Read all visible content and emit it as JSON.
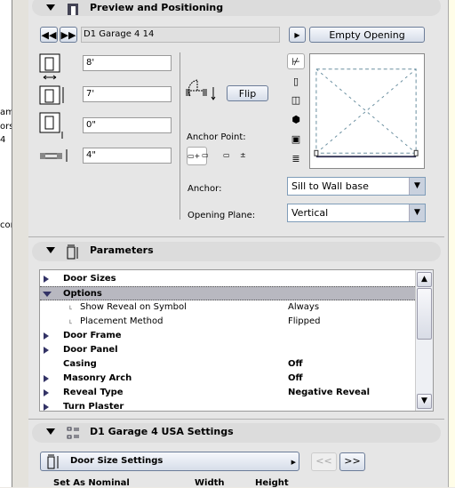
{
  "left_fragments": [
    "am",
    "ors",
    "4",
    "cor"
  ],
  "preview_section": {
    "title": "Preview and Positioning",
    "object_name": "D1 Garage 4 14",
    "empty_opening_label": "Empty Opening",
    "width": "8'",
    "height": "7'",
    "sill_height": "0\"",
    "reveal_depth": "4\"",
    "flip_label": "Flip",
    "anchor_point_label": "Anchor Point:",
    "anchor_label": "Anchor:",
    "anchor_value": "Sill to Wall base",
    "opening_plane_label": "Opening Plane:",
    "opening_plane_value": "Vertical"
  },
  "parameters_section": {
    "title": "Parameters",
    "rows": [
      {
        "name": "Door Sizes",
        "value": "",
        "bold": true,
        "expander": "collapsed"
      },
      {
        "name": "Options",
        "value": "",
        "bold": true,
        "expander": "expanded",
        "selected": true
      },
      {
        "name": "Show Reveal on Symbol",
        "value": "Always",
        "bold": false,
        "expander": "child"
      },
      {
        "name": "Placement Method",
        "value": "Flipped",
        "bold": false,
        "expander": "child"
      },
      {
        "name": "Door Frame",
        "value": "",
        "bold": true,
        "expander": "collapsed"
      },
      {
        "name": "Door Panel",
        "value": "",
        "bold": true,
        "expander": "collapsed"
      },
      {
        "name": "Casing",
        "value": "Off",
        "bold": true,
        "expander": "none"
      },
      {
        "name": "Masonry Arch",
        "value": "Off",
        "bold": true,
        "expander": "collapsed"
      },
      {
        "name": "Reveal Type",
        "value": "Negative Reveal",
        "bold": true,
        "expander": "collapsed"
      },
      {
        "name": "Turn Plaster",
        "value": "",
        "bold": true,
        "expander": "collapsed"
      }
    ]
  },
  "settings_section": {
    "title": "D1 Garage 4 USA Settings",
    "page_label": "Door Size Settings",
    "prev_label": "<<",
    "next_label": ">>",
    "col_set_as_nominal": "Set As Nominal",
    "col_width": "Width",
    "col_height": "Height"
  }
}
